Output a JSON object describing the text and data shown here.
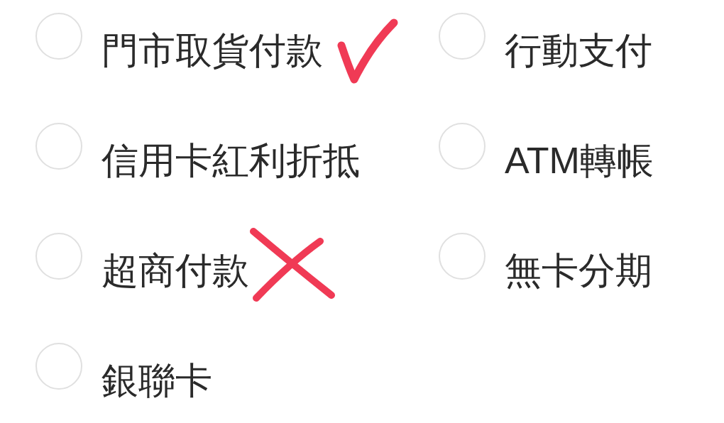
{
  "options": [
    {
      "label": "門市取貨付款",
      "selected": false,
      "ticked": true,
      "crossed": false
    },
    {
      "label": "行動支付",
      "selected": false,
      "ticked": false,
      "crossed": false
    },
    {
      "label": "信用卡紅利折抵",
      "selected": false,
      "ticked": false,
      "crossed": false
    },
    {
      "label": "ATM轉帳",
      "selected": false,
      "ticked": false,
      "crossed": false
    },
    {
      "label": "超商付款",
      "selected": false,
      "ticked": false,
      "crossed": true
    },
    {
      "label": "無卡分期",
      "selected": false,
      "ticked": false,
      "crossed": false
    },
    {
      "label": "銀聯卡",
      "selected": false,
      "ticked": false,
      "crossed": false
    }
  ]
}
